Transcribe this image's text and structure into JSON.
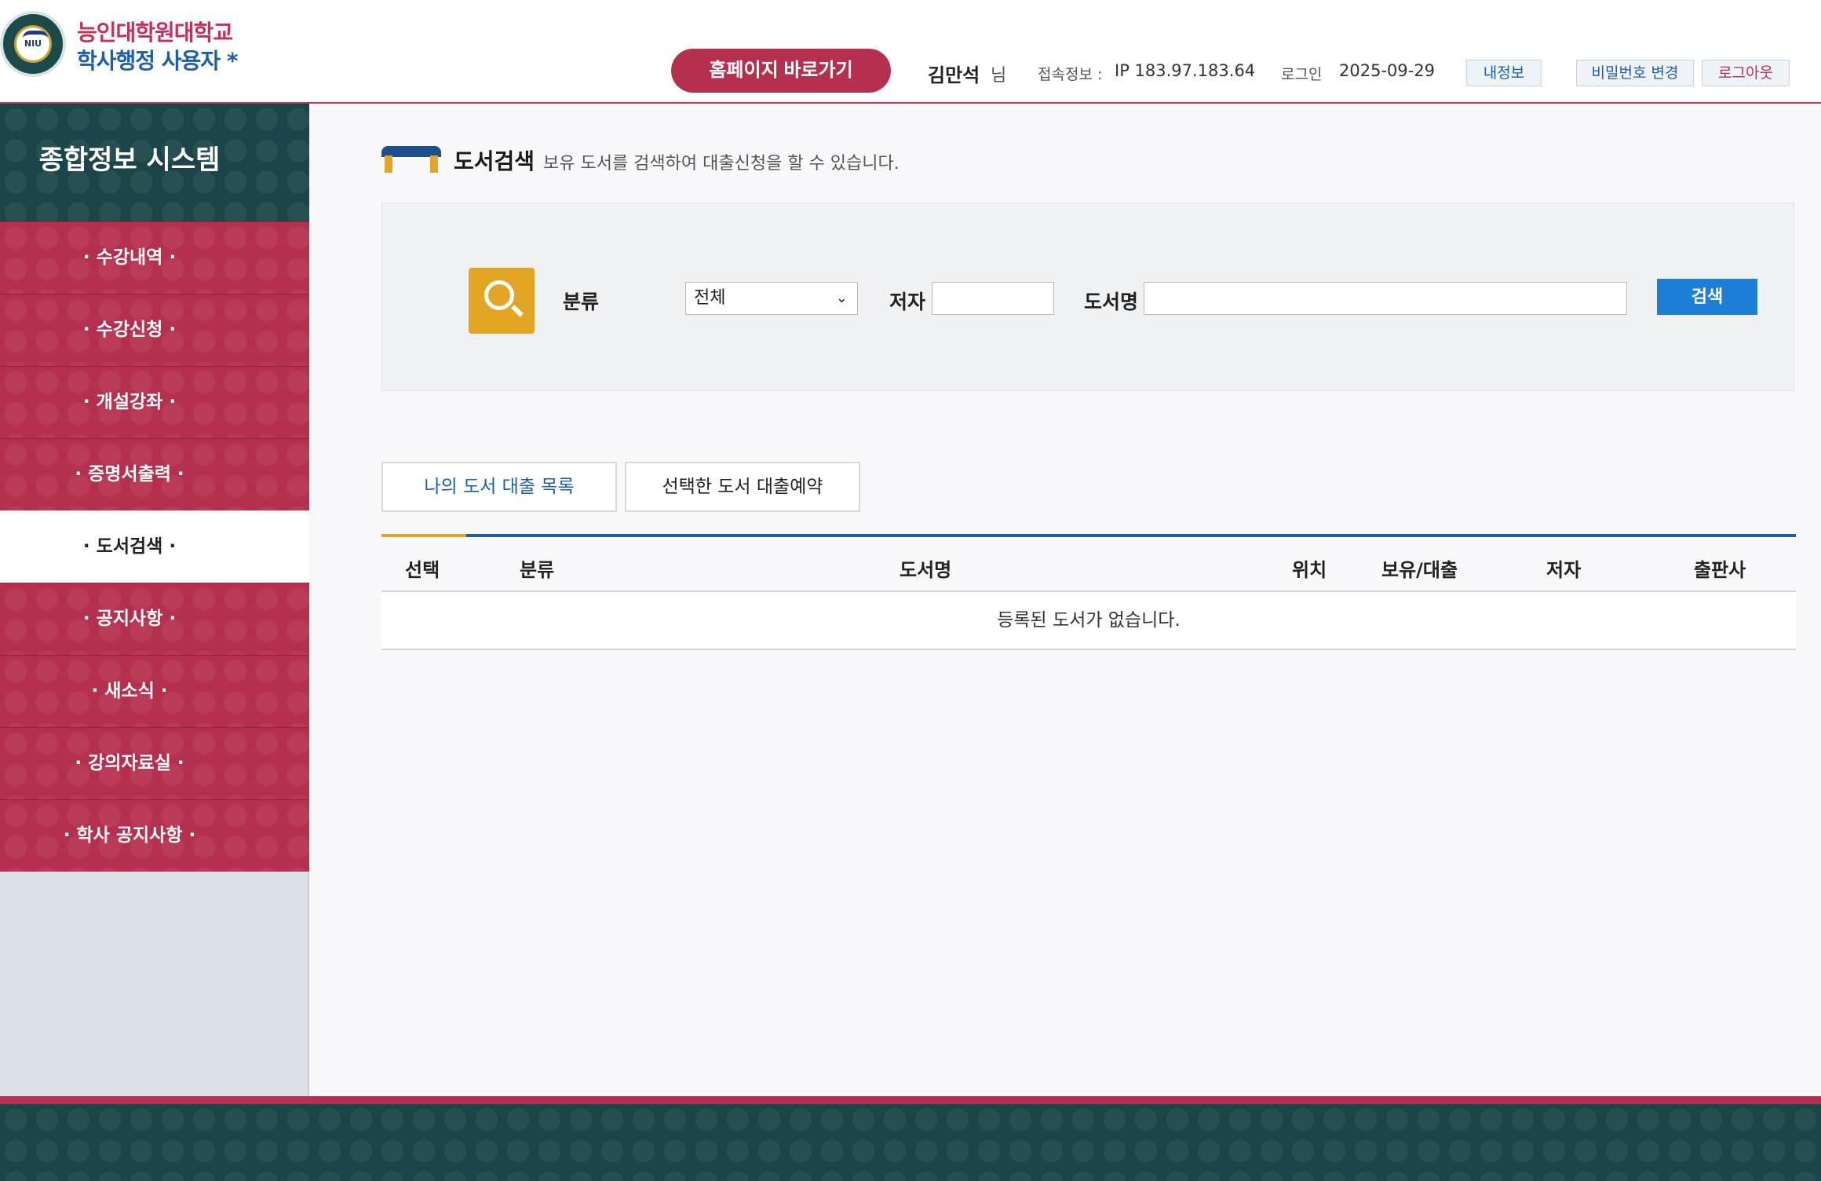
{
  "header": {
    "univ_name": "능인대학원대학교",
    "univ_sub": "학사행정 사용자 *",
    "logo_text": "NIU",
    "homepage_button": "홈페이지 바로가기",
    "user_name": "김만석",
    "user_suffix": "님",
    "ip_label": "접속정보 :",
    "ip_value": "IP 183.97.183.64",
    "login_label": "로그인",
    "login_value": "2025-09-29",
    "myinfo_button": "내정보",
    "password_button": "비밀번호 변경",
    "logout_button": "로그아웃"
  },
  "sidebar": {
    "title": "종합정보 시스템",
    "items": [
      {
        "label": "· 수강내역 ·"
      },
      {
        "label": "· 수강신청 ·"
      },
      {
        "label": "· 개설강좌 ·"
      },
      {
        "label": "· 증명서출력 ·"
      },
      {
        "label": "· 도서검색 ·"
      },
      {
        "label": "· 공지사항 ·"
      },
      {
        "label": "· 새소식 ·"
      },
      {
        "label": "· 강의자료실 ·"
      },
      {
        "label": "· 학사 공지사항 ·"
      }
    ],
    "active_index": 4
  },
  "main": {
    "section_title": "도서검색",
    "section_desc": "보유 도서를 검색하여 대출신청을 할 수 있습니다.",
    "search": {
      "category_label": "분류",
      "category_value": "전체",
      "author_label": "저자",
      "author_value": "",
      "title_label": "도서명",
      "title_value": "",
      "search_button": "검색"
    },
    "tabs": {
      "my_loans": "나의 도서 대출 목록",
      "reserve_selected": "선택한 도서 대출예약"
    },
    "table": {
      "columns": [
        "선택",
        "분류",
        "도서명",
        "위치",
        "보유/대출",
        "저자",
        "출판사"
      ],
      "empty_message": "등록된 도서가 없습니다."
    }
  },
  "colors": {
    "brand_red": "#b5304f",
    "brand_teal": "#1b4548",
    "accent_gold": "#e3a524",
    "accent_blue": "#1c7ed6"
  }
}
